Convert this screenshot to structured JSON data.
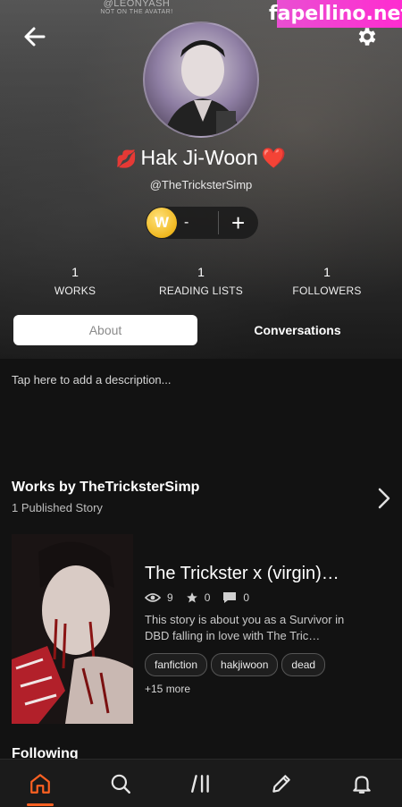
{
  "watermarks": {
    "top_line1": "@LEONYASH",
    "top_line2": "NOT ON THE AVATAR!",
    "brand": "fapellino.net"
  },
  "profile": {
    "display_name": "Hak Ji-Woon",
    "name_prefix_emoji": "💋",
    "name_suffix_emoji": "❤️",
    "handle": "@TheTricksterSimp",
    "coins": {
      "icon_letter": "W",
      "value": "-",
      "add_label": "+"
    }
  },
  "stats": [
    {
      "number": "1",
      "label": "WORKS"
    },
    {
      "number": "1",
      "label": "READING LISTS"
    },
    {
      "number": "1",
      "label": "FOLLOWERS"
    }
  ],
  "tabs": {
    "about": "About",
    "conversations": "Conversations"
  },
  "about": {
    "description_prompt": "Tap here to add a description..."
  },
  "works": {
    "title": "Works by TheTricksterSimp",
    "subtitle": "1 Published Story",
    "story": {
      "title": "The Trickster x (virgin)…",
      "reads": "9",
      "votes": "0",
      "comments": "0",
      "description": "This story is about you as a Survivor in DBD falling in love with The Tric…",
      "tags": [
        "fanfiction",
        "hakjiwoon",
        "dead"
      ],
      "more_tags": "+15 more"
    }
  },
  "following": {
    "title": "Following"
  },
  "colors": {
    "accent": "#ff6122",
    "coin": "#f0b820",
    "brand_watermark": "#ff2cd0"
  },
  "nav": [
    "home-icon",
    "search-icon",
    "library-icon",
    "write-icon",
    "notifications-icon"
  ]
}
